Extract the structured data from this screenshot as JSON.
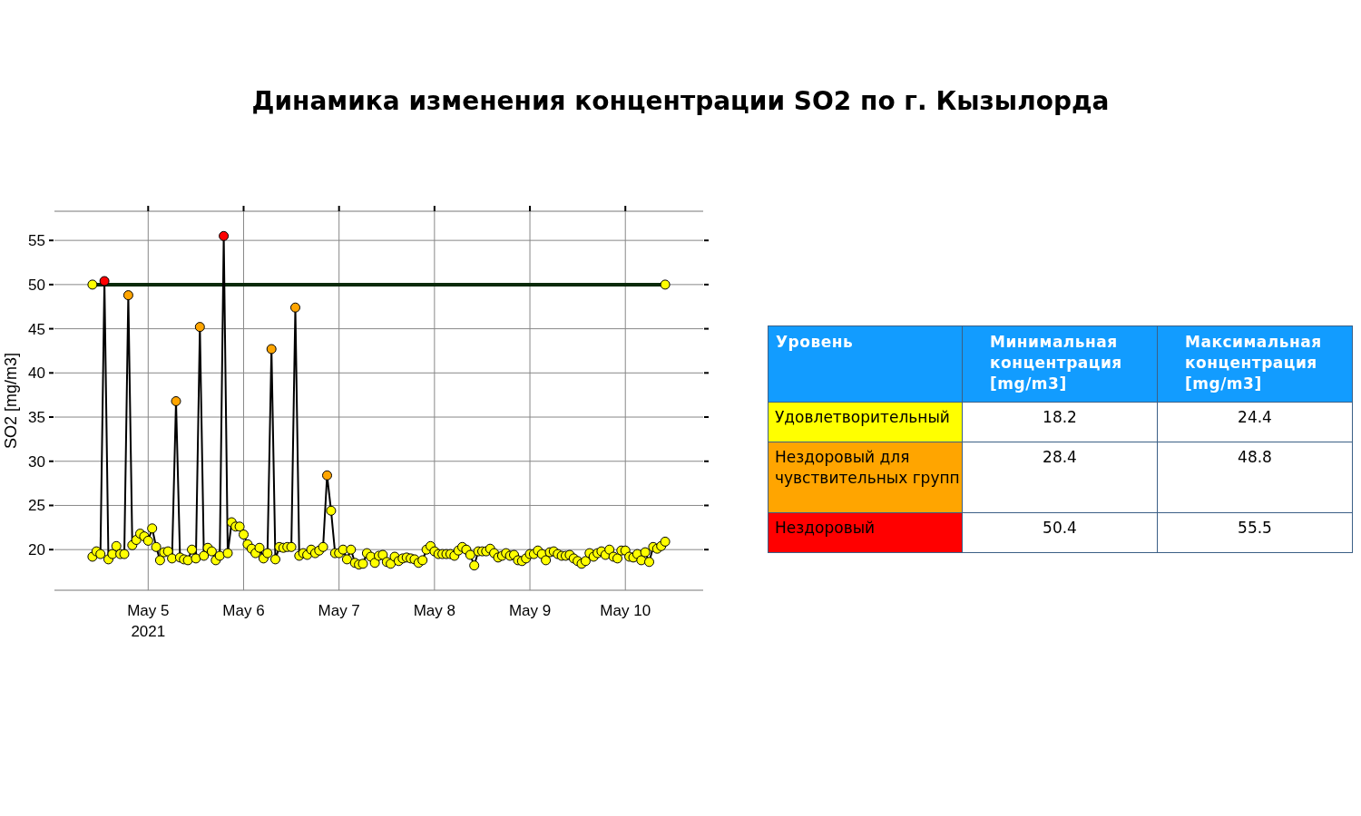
{
  "title": "Динамика изменения концентрации SO2 по г. Кызылорда",
  "chart": {
    "axis_year": "2021",
    "chart_data": {
      "type": "line",
      "ylabel": "SO2 [mg/m3]",
      "grid": true,
      "ylim": [
        15.4,
        58.3
      ],
      "yticks": [
        20,
        25,
        30,
        35,
        40,
        45,
        50,
        55
      ],
      "categories": [
        null,
        null,
        null,
        null,
        null,
        null,
        null,
        null,
        null,
        null,
        null,
        null,
        null,
        null,
        "May 5",
        null,
        null,
        null,
        null,
        null,
        null,
        null,
        null,
        null,
        null,
        null,
        null,
        null,
        null,
        null,
        null,
        null,
        null,
        null,
        null,
        null,
        null,
        null,
        "May 6",
        null,
        null,
        null,
        null,
        null,
        null,
        null,
        null,
        null,
        null,
        null,
        null,
        null,
        null,
        null,
        null,
        null,
        null,
        null,
        null,
        null,
        null,
        null,
        "May 7",
        null,
        null,
        null,
        null,
        null,
        null,
        null,
        null,
        null,
        null,
        null,
        null,
        null,
        null,
        null,
        null,
        null,
        null,
        null,
        null,
        null,
        null,
        null,
        "May 8",
        null,
        null,
        null,
        null,
        null,
        null,
        null,
        null,
        null,
        null,
        null,
        null,
        null,
        null,
        null,
        null,
        null,
        null,
        null,
        null,
        null,
        null,
        null,
        "May 9",
        null,
        null,
        null,
        null,
        null,
        null,
        null,
        null,
        null,
        null,
        null,
        null,
        null,
        null,
        null,
        null,
        null,
        null,
        null,
        null,
        null,
        null,
        null,
        "May 10",
        null,
        null,
        null,
        null,
        null,
        null,
        null,
        null,
        null,
        null
      ],
      "series": [
        {
          "color": "#000000",
          "marker": "circle",
          "values": [
            19.2,
            19.8,
            19.5,
            50.4,
            18.9,
            19.5,
            20.4,
            19.5,
            19.5,
            48.8,
            20.5,
            21.1,
            21.8,
            21.5,
            21.0,
            22.4,
            20.3,
            18.8,
            19.7,
            19.8,
            19.0,
            36.8,
            19.1,
            18.9,
            18.8,
            20.0,
            19.0,
            45.2,
            19.3,
            20.2,
            19.8,
            18.8,
            19.3,
            55.5,
            19.6,
            23.1,
            22.6,
            22.6,
            21.7,
            20.6,
            20.1,
            19.6,
            20.2,
            19.0,
            19.6,
            42.7,
            18.9,
            20.3,
            20.2,
            20.3,
            20.3,
            47.4,
            19.3,
            19.6,
            19.4,
            20.0,
            19.6,
            19.9,
            20.3,
            28.4,
            24.4,
            19.6,
            19.6,
            20.0,
            18.9,
            20.0,
            18.5,
            18.3,
            18.4,
            19.6,
            19.2,
            18.5,
            19.3,
            19.4,
            18.6,
            18.4,
            19.2,
            18.7,
            19.0,
            19.1,
            19.0,
            18.9,
            18.5,
            18.8,
            20.0,
            20.4,
            19.8,
            19.5,
            19.5,
            19.5,
            19.5,
            19.3,
            19.9,
            20.3,
            20.0,
            19.4,
            18.2,
            19.8,
            19.8,
            19.8,
            20.1,
            19.6,
            19.1,
            19.3,
            19.6,
            19.3,
            19.4,
            18.8,
            18.7,
            19.0,
            19.5,
            19.5,
            19.9,
            19.5,
            18.8,
            19.7,
            19.8,
            19.5,
            19.3,
            19.3,
            19.4,
            19.0,
            18.7,
            18.4,
            18.7,
            19.6,
            19.2,
            19.6,
            19.8,
            19.4,
            20.0,
            19.2,
            19.0,
            19.9,
            19.9,
            19.2,
            19.1,
            19.5,
            18.8,
            19.7,
            18.6,
            20.3,
            20.1,
            20.4,
            20.9
          ]
        },
        {
          "color": "#0a2a0a",
          "marker": "circle",
          "values": [
            50,
            null,
            null,
            null,
            null,
            null,
            null,
            null,
            null,
            null,
            null,
            null,
            null,
            null,
            null,
            null,
            null,
            null,
            null,
            null,
            null,
            null,
            null,
            null,
            null,
            null,
            null,
            null,
            null,
            null,
            null,
            null,
            null,
            null,
            null,
            null,
            null,
            null,
            null,
            null,
            null,
            null,
            null,
            null,
            null,
            null,
            null,
            null,
            null,
            null,
            null,
            null,
            null,
            null,
            null,
            null,
            null,
            null,
            null,
            null,
            null,
            null,
            null,
            null,
            null,
            null,
            null,
            null,
            null,
            null,
            null,
            null,
            null,
            null,
            null,
            null,
            null,
            null,
            null,
            null,
            null,
            null,
            null,
            null,
            null,
            null,
            null,
            null,
            null,
            null,
            null,
            null,
            null,
            null,
            null,
            null,
            null,
            null,
            null,
            null,
            null,
            null,
            null,
            null,
            null,
            null,
            null,
            null,
            null,
            null,
            null,
            null,
            null,
            null,
            null,
            null,
            null,
            null,
            null,
            null,
            null,
            null,
            null,
            null,
            null,
            null,
            null,
            null,
            null,
            null,
            null,
            null,
            null,
            null,
            null,
            null,
            null,
            null,
            null,
            null,
            null,
            null,
            null,
            null,
            50
          ]
        }
      ]
    }
  },
  "table": {
    "columns": [
      "Уровень",
      "Минимальная концентрация [mg/m3]",
      "Максимальная концентрация [mg/m3]"
    ],
    "rows": [
      {
        "level": "Удовлетворительный",
        "min": "18.2",
        "max": "24.4",
        "color": "#ffff00"
      },
      {
        "level": "Нездоровый для чувствительных групп",
        "min": "28.4",
        "max": "48.8",
        "color": "#ffa500"
      },
      {
        "level": "Нездоровый",
        "min": "50.4",
        "max": "55.5",
        "color": "#ff0000"
      }
    ]
  }
}
